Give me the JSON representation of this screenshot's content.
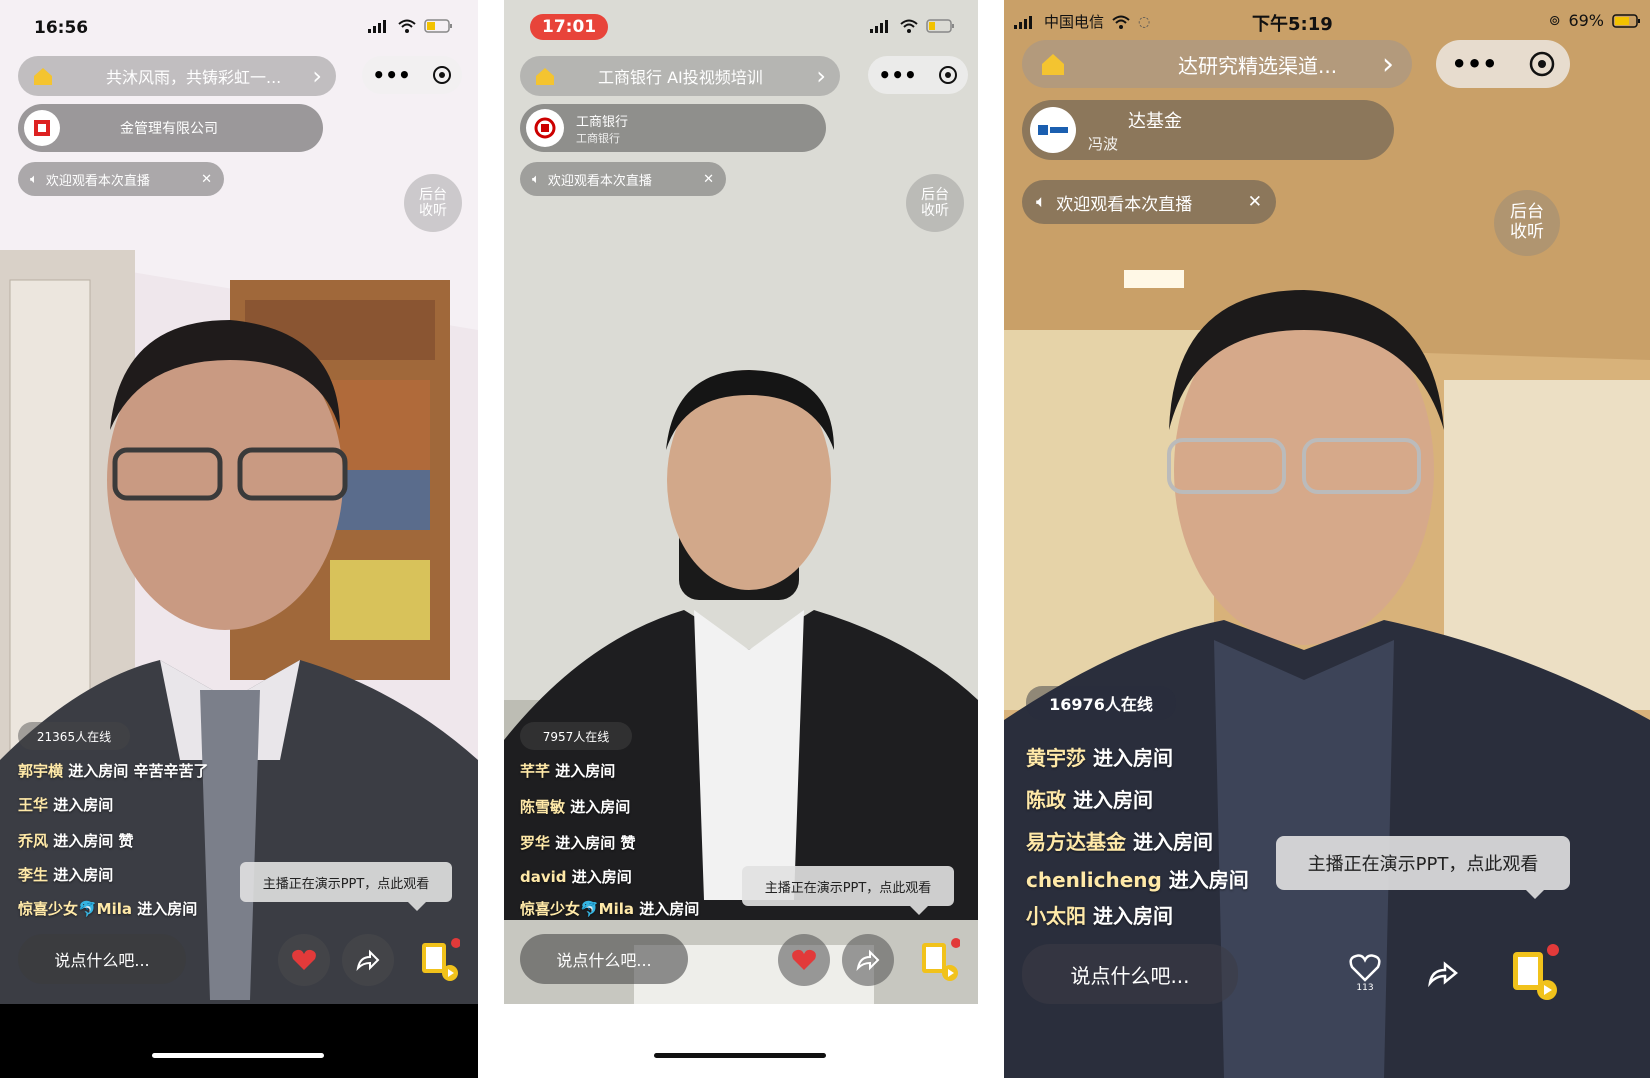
{
  "phones": [
    {
      "status_time": "16:56",
      "nav_title": "共沐风雨，共铸彩虹一...",
      "host_name": "金管理有限公司",
      "host_sub": "",
      "welcome": "欢迎观看本次直播",
      "bg_listen_1": "后台",
      "bg_listen_2": "收听",
      "online": "21365人在线",
      "comments": [
        {
          "name": "郭宇横",
          "action": "进入房间",
          "extra": "辛苦辛苦了"
        },
        {
          "name": "王华",
          "action": "进入房间",
          "extra": ""
        },
        {
          "name": "乔风",
          "action": "进入房间",
          "extra": "赞"
        },
        {
          "name": "李生",
          "action": "进入房间",
          "extra": ""
        },
        {
          "name": "惊喜少女🐬Mila",
          "action": "进入房间",
          "extra": ""
        }
      ],
      "ppt_notice": "主播正在演示PPT，点此观看",
      "say_placeholder": "说点什么吧...",
      "like_count": ""
    },
    {
      "status_time": "17:01",
      "nav_title": "工商银行 AI投视频培训",
      "host_name": "工商银行",
      "host_sub": "工商银行",
      "welcome": "欢迎观看本次直播",
      "bg_listen_1": "后台",
      "bg_listen_2": "收听",
      "online": "7957人在线",
      "comments": [
        {
          "name": "芊芊",
          "action": "进入房间",
          "extra": ""
        },
        {
          "name": "陈雪敏",
          "action": "进入房间",
          "extra": ""
        },
        {
          "name": "罗华",
          "action": "进入房间",
          "extra": "赞"
        },
        {
          "name": "david",
          "action": "进入房间",
          "extra": ""
        },
        {
          "name": "惊喜少女🐬Mila",
          "action": "进入房间",
          "extra": ""
        }
      ],
      "ppt_notice": "主播正在演示PPT，点此观看",
      "say_placeholder": "说点什么吧...",
      "like_count": ""
    },
    {
      "status_carrier": "中国电信",
      "status_time": "下午5:19",
      "status_battery": "69%",
      "nav_title": "达研究精选渠道...",
      "host_name": "达基金",
      "host_sub": "冯波",
      "welcome": "欢迎观看本次直播",
      "bg_listen_1": "后台",
      "bg_listen_2": "收听",
      "online": "16976人在线",
      "comments": [
        {
          "name": "黄宇莎",
          "action": "进入房间",
          "extra": ""
        },
        {
          "name": "陈政",
          "action": "进入房间",
          "extra": ""
        },
        {
          "name": "易方达基金",
          "action": "进入房间",
          "extra": ""
        },
        {
          "name": "chenlicheng",
          "action": "进入房间",
          "extra": ""
        },
        {
          "name": "小太阳",
          "action": "进入房间",
          "extra": ""
        }
      ],
      "ppt_notice": "主播正在演示PPT，点此观看",
      "say_placeholder": "说点什么吧...",
      "like_count": "113"
    }
  ],
  "colors": {
    "pill_gray": "#9a9a9a",
    "heart_red": "#e23a3a",
    "ppt_yellow": "#f1c21b",
    "time_badge_red": "#e8443a"
  }
}
